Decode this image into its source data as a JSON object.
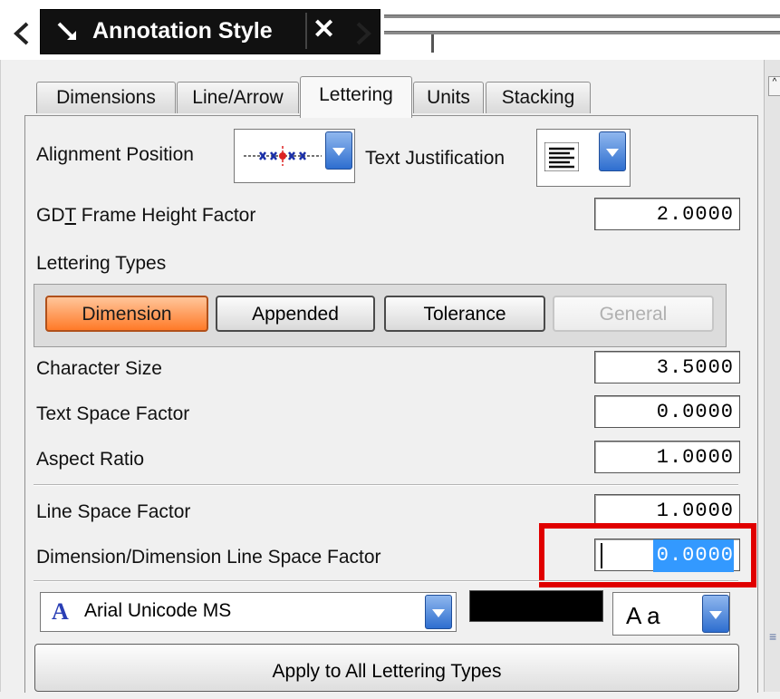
{
  "titlebar": {
    "title": "Annotation Style",
    "close_glyph": "✕"
  },
  "tabs": [
    {
      "label": "Dimensions",
      "active": false
    },
    {
      "label": "Line/Arrow",
      "active": false
    },
    {
      "label": "Lettering",
      "active": true
    },
    {
      "label": "Units",
      "active": false
    },
    {
      "label": "Stacking",
      "active": false
    }
  ],
  "alignment": {
    "label": "Alignment Position",
    "text_justification_label": "Text Justification"
  },
  "gdt": {
    "label_pre": "GD",
    "label_u": "T",
    "label_post": " Frame Height Factor",
    "value": "2.0000"
  },
  "lettering_types": {
    "label": "Lettering Types",
    "buttons": [
      {
        "label": "Dimension",
        "state": "active"
      },
      {
        "label": "Appended",
        "state": "normal"
      },
      {
        "label": "Tolerance",
        "state": "normal"
      },
      {
        "label": "General",
        "state": "disabled"
      }
    ]
  },
  "fields": {
    "character_size": {
      "label": "Character Size",
      "value": "3.5000"
    },
    "text_space_factor": {
      "label": "Text Space Factor",
      "value": "0.0000"
    },
    "aspect_ratio": {
      "label": "Aspect Ratio",
      "value": "1.0000"
    },
    "line_space_factor": {
      "label": "Line Space Factor",
      "value": "1.0000"
    },
    "dim_line_space_factor": {
      "label": "Dimension/Dimension Line Space Factor",
      "value": "0.0000"
    }
  },
  "font": {
    "icon": "font-A-icon",
    "glyph": "A",
    "name": "Arial Unicode MS",
    "color": "#000000",
    "style_sample": "A a"
  },
  "apply_button": "Apply to All Lettering Types",
  "colors": {
    "highlight": "#e00000",
    "active_button": "#ff7a28",
    "selection": "#3399ff",
    "dropdown": "#2e6ecf"
  }
}
